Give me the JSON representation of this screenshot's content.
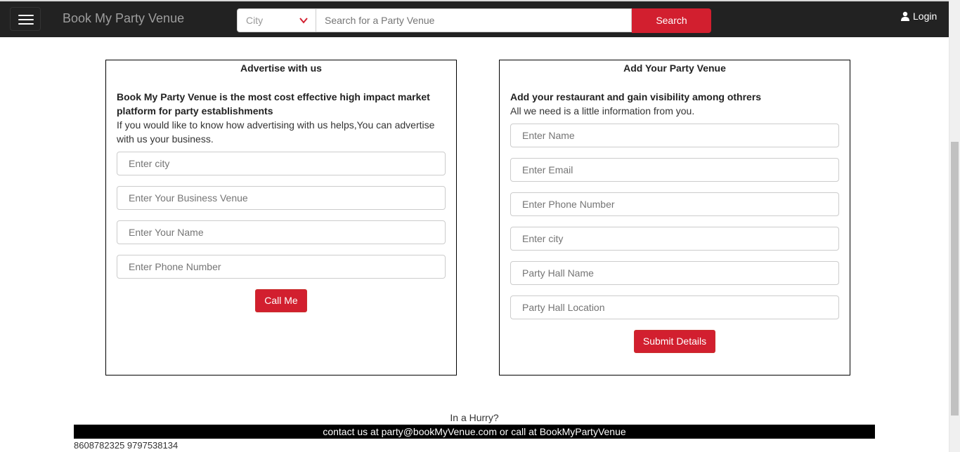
{
  "navbar": {
    "brand": "Book My Party Venue",
    "city_select": "City",
    "search_placeholder": "Search for a Party Venue",
    "search_button": "Search",
    "login": "Login"
  },
  "advertise": {
    "title": "Advertise with us",
    "lead": "Book My Party Venue is the most cost effective high impact market platform for party establishments",
    "description": "If you would like to know how advertising with us helps,You can advertise with us your business.",
    "fields": {
      "city": "Enter city",
      "business": "Enter Your Business Venue",
      "name": "Enter Your Name",
      "phone": "Enter Phone Number"
    },
    "button": "Call Me"
  },
  "add_venue": {
    "title": "Add Your Party Venue",
    "lead": "Add your restaurant and gain visibility among othrers",
    "description": "All we need is a little information from you.",
    "fields": {
      "name": "Enter Name",
      "email": "Enter Email",
      "phone": "Enter Phone Number",
      "city": "Enter city",
      "hall_name": "Party Hall Name",
      "hall_location": "Party Hall Location"
    },
    "button": "Submit Details"
  },
  "footer": {
    "hurry": "In a Hurry?",
    "contact": "contact us at party@bookMyVenue.com or call at BookMyPartyVenue",
    "phones": "8608782325 9797538134"
  },
  "colors": {
    "navbar_bg": "#222222",
    "accent_red": "#d21f2f"
  },
  "icons": {
    "menu": "hamburger-menu-icon",
    "city_dropdown": "chevron-down-icon",
    "login": "user-icon"
  }
}
